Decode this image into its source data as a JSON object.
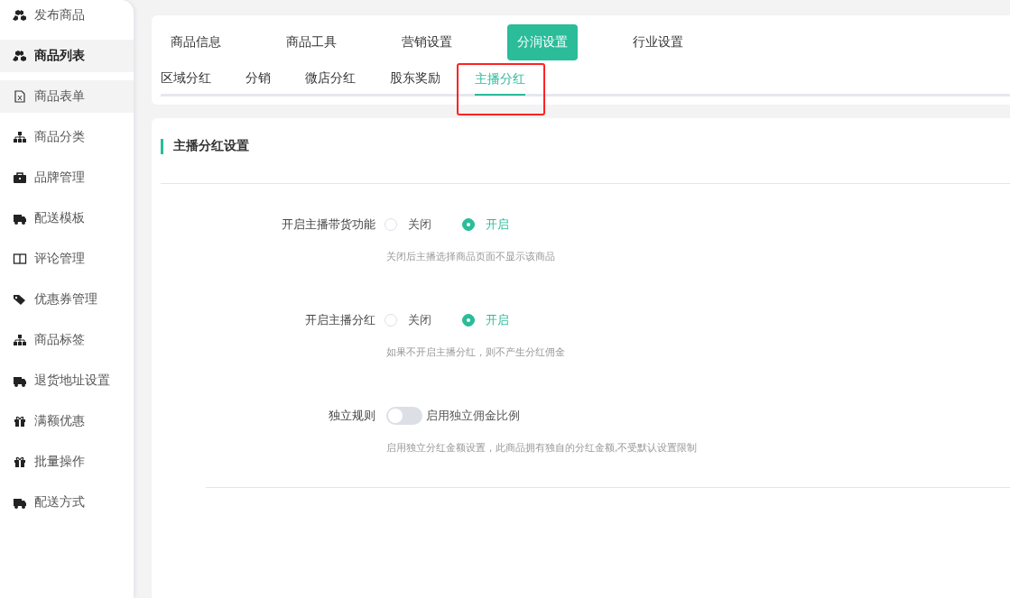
{
  "sidebar": {
    "items": [
      {
        "label": "发布商品",
        "kind": "cubes",
        "selected": false,
        "hovered": false
      },
      {
        "label": "商品列表",
        "kind": "cubes",
        "selected": true,
        "hovered": false
      },
      {
        "label": "商品表单",
        "kind": "file",
        "selected": false,
        "hovered": true
      },
      {
        "label": "商品分类",
        "kind": "sitemap",
        "selected": false,
        "hovered": false
      },
      {
        "label": "品牌管理",
        "kind": "briefcase",
        "selected": false,
        "hovered": false
      },
      {
        "label": "配送模板",
        "kind": "truck",
        "selected": false,
        "hovered": false
      },
      {
        "label": "评论管理",
        "kind": "columns",
        "selected": false,
        "hovered": false
      },
      {
        "label": "优惠券管理",
        "kind": "tags",
        "selected": false,
        "hovered": false
      },
      {
        "label": "商品标签",
        "kind": "sitemap",
        "selected": false,
        "hovered": false
      },
      {
        "label": "退货地址设置",
        "kind": "truck",
        "selected": false,
        "hovered": false
      },
      {
        "label": "满额优惠",
        "kind": "gift",
        "selected": false,
        "hovered": false
      },
      {
        "label": "批量操作",
        "kind": "gift",
        "selected": false,
        "hovered": false
      },
      {
        "label": "配送方式",
        "kind": "truck",
        "selected": false,
        "hovered": false
      }
    ]
  },
  "tabs": [
    {
      "label": "商品信息",
      "selected": false
    },
    {
      "label": "商品工具",
      "selected": false
    },
    {
      "label": "营销设置",
      "selected": false
    },
    {
      "label": "分润设置",
      "selected": true
    },
    {
      "label": "行业设置",
      "selected": false
    }
  ],
  "subtabs": [
    {
      "label": "区域分红",
      "selected": false,
      "highlighted": false
    },
    {
      "label": "分销",
      "selected": false,
      "highlighted": false
    },
    {
      "label": "微店分红",
      "selected": false,
      "highlighted": false
    },
    {
      "label": "股东奖励",
      "selected": false,
      "highlighted": false
    },
    {
      "label": "主播分红",
      "selected": true,
      "highlighted": true
    }
  ],
  "section": {
    "title": "主播分红设置"
  },
  "form": [
    {
      "kind": "radio",
      "label": "开启主播带货功能",
      "options": [
        {
          "label": "关闭",
          "selected": false
        },
        {
          "label": "开启",
          "selected": true
        }
      ],
      "hint": "关闭后主播选择商品页面不显示该商品"
    },
    {
      "kind": "radio",
      "label": "开启主播分红",
      "options": [
        {
          "label": "关闭",
          "selected": false
        },
        {
          "label": "开启",
          "selected": true
        }
      ],
      "hint": "如果不开启主播分红，则不产生分红佣金"
    },
    {
      "kind": "switch",
      "label": "独立规则",
      "on": false,
      "text": "启用独立佣金比例",
      "hint": "启用独立分红金额设置，此商品拥有独自的分红金额,不受默认设置限制"
    }
  ]
}
